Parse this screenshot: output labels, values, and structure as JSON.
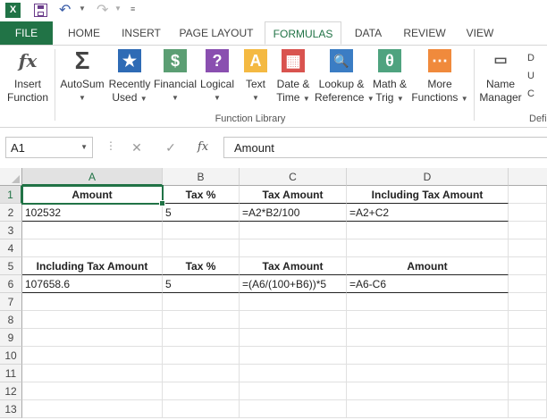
{
  "app": {
    "logo": "X",
    "icons": [
      "excel-logo-icon",
      "save-icon",
      "undo-icon",
      "redo-icon",
      "customize-icon"
    ]
  },
  "tabs": [
    "FILE",
    "HOME",
    "INSERT",
    "PAGE LAYOUT",
    "FORMULAS",
    "DATA",
    "REVIEW",
    "VIEW"
  ],
  "active_tab": "FORMULAS",
  "ribbon": {
    "insert_function": {
      "line1": "Insert",
      "line2": "Function",
      "glyph": "fx"
    },
    "autosum": {
      "line1": "AutoSum",
      "glyph": "Σ"
    },
    "recently_used": {
      "line1": "Recently",
      "line2": "Used",
      "glyph": "★"
    },
    "financial": {
      "line1": "Financial",
      "glyph": "$"
    },
    "logical": {
      "line1": "Logical",
      "glyph": "?"
    },
    "text": {
      "line1": "Text",
      "glyph": "A"
    },
    "date_time": {
      "line1": "Date &",
      "line2": "Time",
      "glyph": "▦"
    },
    "lookup_reference": {
      "line1": "Lookup &",
      "line2": "Reference",
      "glyph": "🔍"
    },
    "math_trig": {
      "line1": "Math &",
      "line2": "Trig",
      "glyph": "θ"
    },
    "more_functions": {
      "line1": "More",
      "line2": "Functions",
      "glyph": "⋯"
    },
    "name_manager": {
      "line1": "Name",
      "line2": "Manager"
    },
    "group_label": "Function Library",
    "partial_group_label": "Defi",
    "partial_items": [
      "D",
      "U",
      "C"
    ],
    "colors": {
      "insert": "#ffffff",
      "autosum": "#ffffff",
      "recently": "#2e6bb5",
      "financial": "#5b9e73",
      "logical": "#8a4fb0",
      "text": "#f4b942",
      "datetime": "#d9534f",
      "lookup": "#3b7dc4",
      "math": "#4fa37f",
      "more": "#f08a3c"
    }
  },
  "formula_bar": {
    "name_box": "A1",
    "content": "Amount",
    "fx": "fx",
    "cancel": "✕",
    "enter": "✓"
  },
  "columns": [
    "A",
    "B",
    "C",
    "D"
  ],
  "rows": [
    "1",
    "2",
    "3",
    "4",
    "5",
    "6",
    "7",
    "8",
    "9",
    "10",
    "11",
    "12",
    "13"
  ],
  "cells": {
    "r1": [
      "Amount",
      "Tax %",
      "Tax Amount",
      "Including Tax Amount"
    ],
    "r2": [
      "102532",
      "5",
      "=A2*B2/100",
      "=A2+C2"
    ],
    "r5": [
      "Including Tax Amount",
      "Tax %",
      "Tax Amount",
      "Amount"
    ],
    "r6": [
      "107658.6",
      "5",
      "=(A6/(100+B6))*5",
      "=A6-C6"
    ]
  },
  "selected_cell": "A1",
  "accent_color": "#217346"
}
